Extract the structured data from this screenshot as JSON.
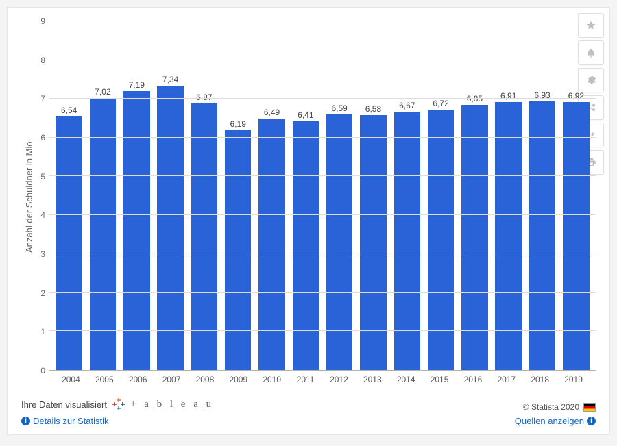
{
  "chart_data": {
    "type": "bar",
    "ylabel": "Anzahl der Schuldner in Mio.",
    "xlabel": "",
    "ylim": [
      0,
      9
    ],
    "yticks": [
      0,
      1,
      2,
      3,
      4,
      5,
      6,
      7,
      8,
      9
    ],
    "categories": [
      "2004",
      "2005",
      "2006",
      "2007",
      "2008",
      "2009",
      "2010",
      "2011",
      "2012",
      "2013",
      "2014",
      "2015",
      "2016",
      "2017",
      "2018",
      "2019"
    ],
    "values": [
      6.54,
      7.02,
      7.19,
      7.34,
      6.87,
      6.19,
      6.49,
      6.41,
      6.59,
      6.58,
      6.67,
      6.72,
      6.85,
      6.91,
      6.93,
      6.92
    ],
    "value_labels": [
      "6,54",
      "7,02",
      "7,19",
      "7,34",
      "6,87",
      "6,19",
      "6,49",
      "6,41",
      "6,59",
      "6,58",
      "6,67",
      "6,72",
      "6,85",
      "6,91",
      "6,93",
      "6,92"
    ]
  },
  "toolbox": {
    "favorite": "favorite",
    "alert": "alert",
    "settings": "settings",
    "share": "share",
    "cite": "cite",
    "print": "print"
  },
  "footer": {
    "promo_text": "Ihre Daten visualisiert",
    "tableau_text": "+ a b l e a u",
    "details_link": "Details zur Statistik",
    "copyright": "© Statista 2020",
    "sources_link": "Quellen anzeigen"
  }
}
